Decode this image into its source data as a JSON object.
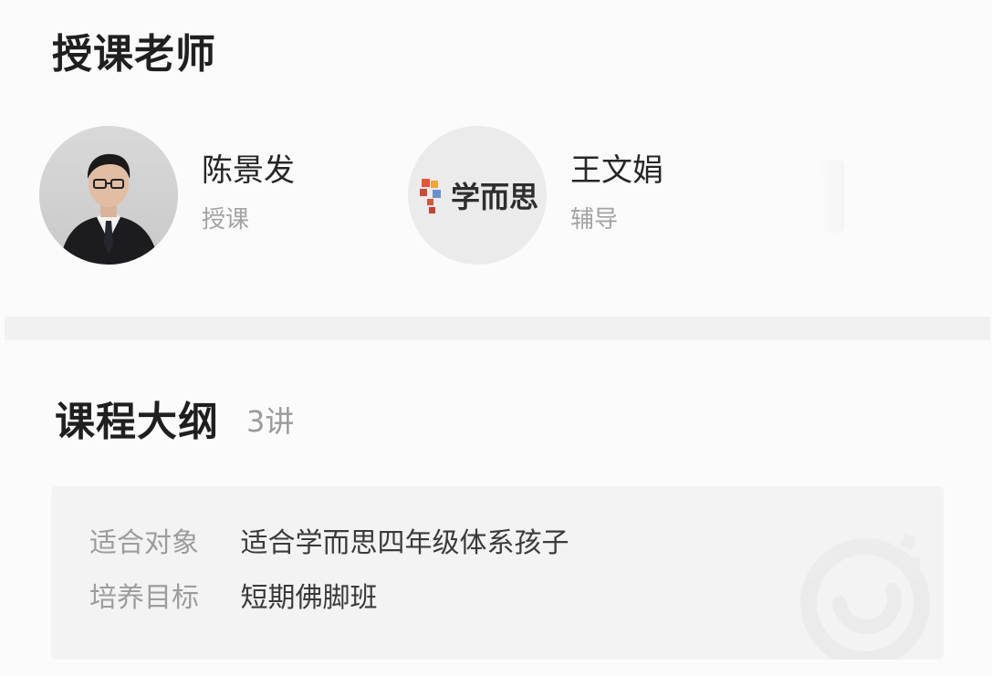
{
  "teachers_section": {
    "title": "授课老师",
    "teachers": [
      {
        "name": "陈景发",
        "role": "授课",
        "avatar": "teacher-photo"
      },
      {
        "name": "王文娟",
        "role": "辅导",
        "avatar": "brand-logo",
        "brand_text": "学而思"
      }
    ]
  },
  "outline_section": {
    "title": "课程大纲",
    "lesson_count": "3讲"
  },
  "course_info": {
    "rows": [
      {
        "label": "适合对象",
        "value": "适合学而思四年级体系孩子"
      },
      {
        "label": "培养目标",
        "value": "短期佛脚班"
      }
    ],
    "watermark_icon": "brand-watermark-icon"
  },
  "colors": {
    "background": "#fbfbfb",
    "title": "#1f1f1f",
    "muted": "#a3a3a3",
    "card": "#f3f3f3"
  }
}
